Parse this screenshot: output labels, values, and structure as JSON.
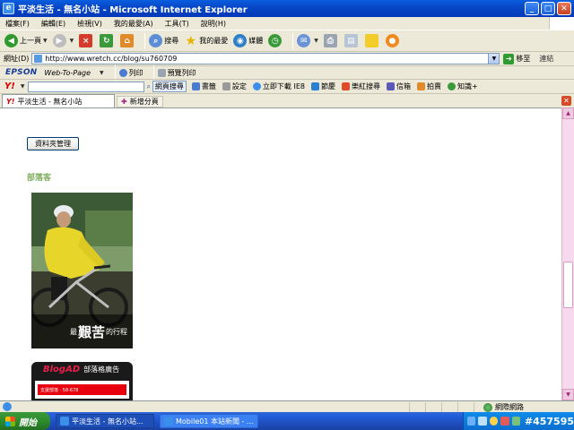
{
  "window": {
    "title": "平淡生活 - 無名小站 - Microsoft Internet Explorer",
    "app_icon_glyph": "e",
    "minimize_glyph": "_",
    "maximize_glyph": "□",
    "close_glyph": "✕"
  },
  "menu": [
    "檔案(F)",
    "編輯(E)",
    "檢視(V)",
    "我的最愛(A)",
    "工具(T)",
    "說明(H)"
  ],
  "toolbar": {
    "back_label": "上一頁",
    "search_label": "搜尋",
    "favorites_label": "我的最愛",
    "media_label": "媒體"
  },
  "address": {
    "label": "網址(D)",
    "url": "http://www.wretch.cc/blog/su760709",
    "go_label": "移至",
    "links_label": "連結"
  },
  "epson": {
    "brand": "EPSON",
    "web_to_page": "Web-To-Page",
    "print": "列印",
    "preview": "預覽列印"
  },
  "yahoo": {
    "logo": "Y!",
    "search_button": "網頁搜尋",
    "items": [
      "書籤",
      "設定",
      "立即下載 IE8",
      "節慶",
      "樂紅搜尋",
      "信箱",
      "拍賣",
      "知識+"
    ]
  },
  "tabs": {
    "active": "平淡生活 - 無名小站",
    "new_tab": "新增分頁",
    "favicon": "Y!"
  },
  "content": {
    "folder_button": "資料夾管理",
    "blogger_heading": "部落客",
    "photo_caption_prefix": "最",
    "photo_caption_big": "艱苦",
    "photo_caption_suffix": "的行程",
    "blogad_brand": "BlogAD",
    "blogad_sub": "部落格廣告",
    "blogad_panel_text": "支援部落 · 58-678"
  },
  "status": {
    "zone": "網際網路"
  },
  "taskbar": {
    "start": "開始",
    "tasks": [
      "平淡生活 - 無名小站...",
      "Mobile01 本站新聞 - ..."
    ],
    "tray_tag": "#457595"
  },
  "colors": {
    "blogger_heading": "#7fae5e",
    "scroll_track": "#f6d9ec",
    "xp_blue": "#0a5fe0"
  }
}
